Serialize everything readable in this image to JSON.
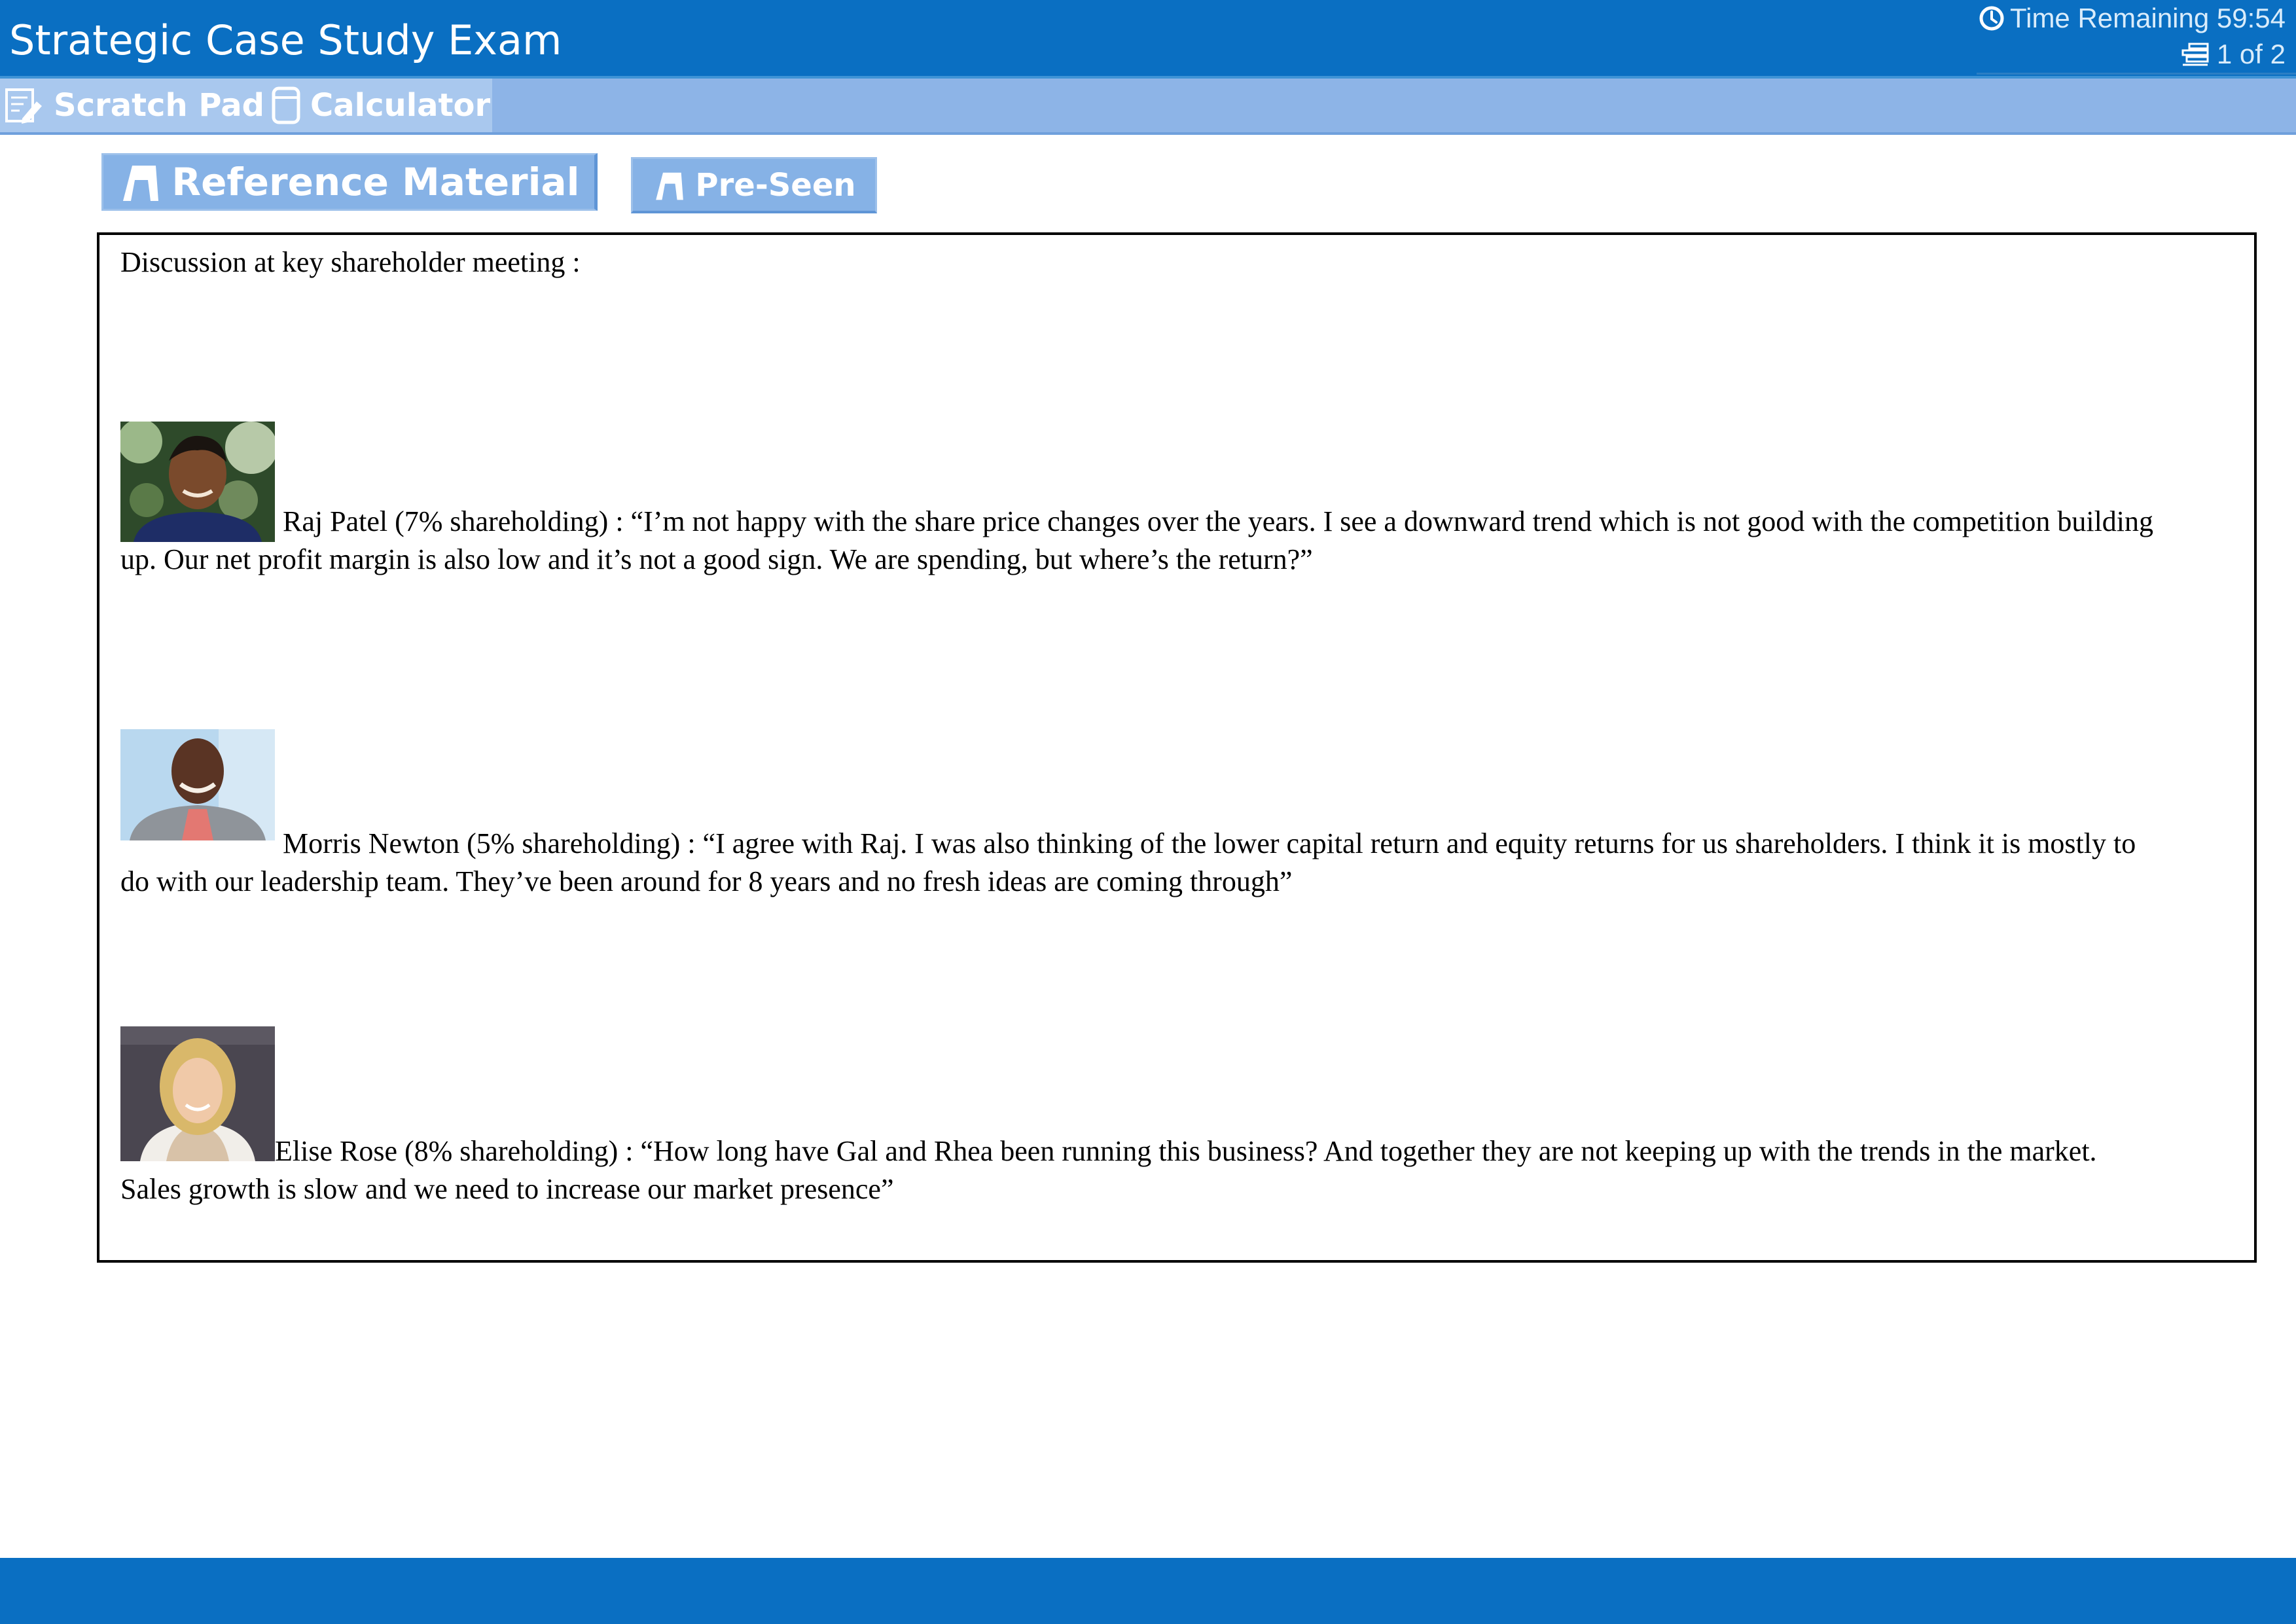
{
  "header": {
    "title": "Strategic Case Study Exam",
    "time_remaining": "Time Remaining 59:54",
    "page_indicator": "1 of 2",
    "clock_icon": "clock-icon",
    "pages_icon": "pages-icon"
  },
  "toolbar": {
    "scratch_pad_label": "Scratch Pad",
    "calculator_label": "Calculator",
    "scratch_pad_icon": "scratch-pad-icon",
    "calculator_icon": "calculator-icon"
  },
  "tabs": {
    "reference_material_label": "Reference Material",
    "pre_seen_label": "Pre-Seen",
    "tab_icon": "bookmark-icon"
  },
  "content": {
    "heading": "Discussion at key shareholder meeting :",
    "comments": [
      {
        "avatar_alt": "Raj Patel",
        "line1": "Raj Patel (7% shareholding) : “I’m not happy with the share price changes over the years. I see a downward trend which is not good with the competition building",
        "line2": "up. Our net profit margin is also low and it’s not a good sign. We are spending, but where’s the return?”"
      },
      {
        "avatar_alt": "Morris Newton",
        "line1": "Morris Newton (5% shareholding) : “I agree with Raj. I was also thinking of the lower capital return and equity returns for us shareholders. I think it is mostly to",
        "line2": "do with our leadership team. They’ve been around for 8 years and no fresh ideas are coming through”"
      },
      {
        "avatar_alt": "Elise Rose",
        "line1": "Elise Rose (8% shareholding) : “How long have Gal and Rhea been running this business? And together they are not keeping up with the trends in the market.",
        "line2": "Sales growth is slow and we need to increase our market presence”"
      }
    ]
  },
  "colors": {
    "title_bar": "#0a6fc2",
    "toolbar": "#8db4e7",
    "tab": "#86b2e6",
    "text": "#000000"
  }
}
